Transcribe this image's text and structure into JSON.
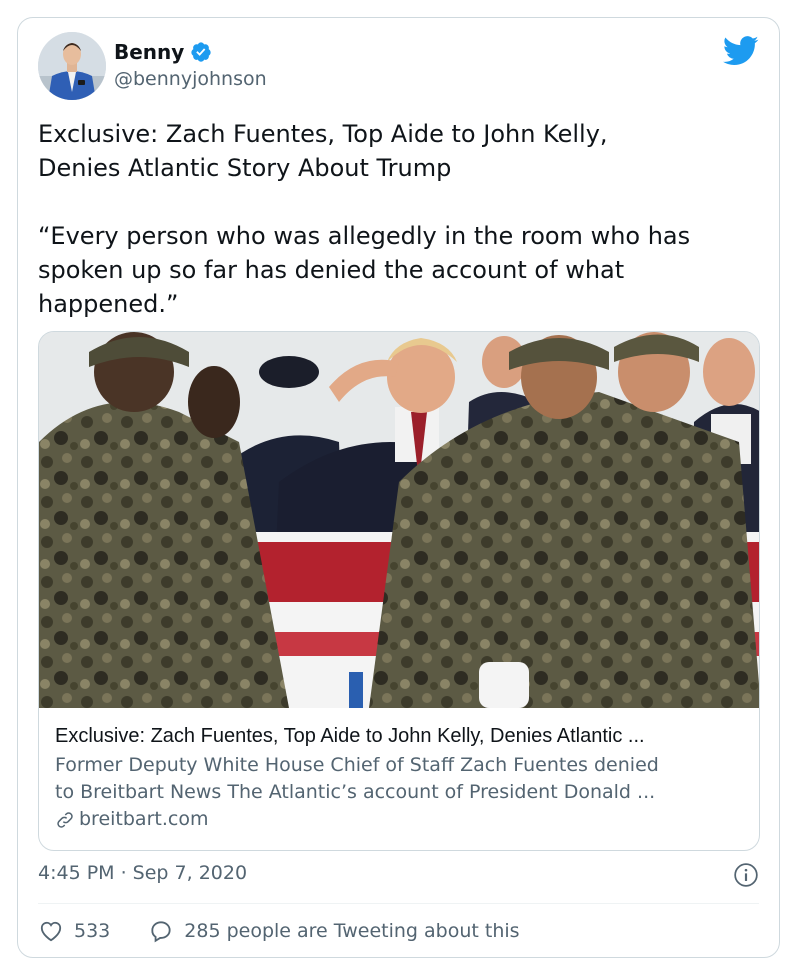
{
  "author": {
    "name": "Benny",
    "handle": "@bennyjohnson",
    "verified": true,
    "avatar_icon": "profile-photo",
    "brand_icon": "twitter-bird-icon",
    "brand_color": "#1d9bf0"
  },
  "tweet": {
    "text": "Exclusive: Zach Fuentes, Top Aide to John Kelly,\nDenies Atlantic Story About Trump\n\n“Every person who was allegedly in the room who has\nspoken up so far has denied the account of what\nhappened.”"
  },
  "link_card": {
    "image_icon": "news-photo",
    "title": "Exclusive: Zach Fuentes, Top Aide to John Kelly, Denies Atlantic ...",
    "description": "Former Deputy White House Chief of Staff Zach Fuentes denied\nto Breitbart News The Atlantic’s account of President Donald ...",
    "domain": "breitbart.com",
    "domain_icon": "link-icon"
  },
  "meta": {
    "timestamp": "4:45 PM · Sep 7, 2020",
    "info_icon": "info-icon"
  },
  "actions": {
    "likes": "533",
    "like_icon": "heart-icon",
    "conversation_label": "285 people are Tweeting about this",
    "conversation_icon": "reply-bubble-icon"
  },
  "colors": {
    "text_primary": "#0f1419",
    "text_secondary": "#536471",
    "border": "#cfd9de"
  }
}
